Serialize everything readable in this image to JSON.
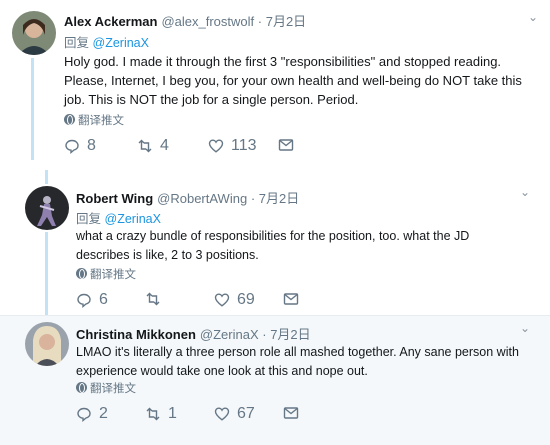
{
  "reply_label": "回复",
  "translate_label": "翻译推文",
  "colors": {
    "link": "#1b95e0",
    "muted": "#657786",
    "thread": "#c4e2f5"
  },
  "tweets": [
    {
      "name": "Alex Ackerman",
      "handle": "@alex_frostwolf",
      "date": "· 7月2日",
      "reply_to": "@ZerinaX",
      "text": "Holy god. I made it through the first 3 \"responsibilities\" and stopped reading. Please, Internet, I beg you, for your own health and well-being do NOT take this job. This is NOT the job for a single person. Period.",
      "replies": "8",
      "retweets": "4",
      "likes": "113"
    },
    {
      "name": "Robert Wing",
      "handle": "@RobertAWing",
      "date": "· 7月2日",
      "reply_to": "@ZerinaX",
      "text": "what a crazy bundle of responsibilities for the position, too. what the JD describes is like, 2 to 3 positions.",
      "replies": "6",
      "retweets": "",
      "likes": "69"
    },
    {
      "name": "Christina Mikkonen",
      "handle": "@ZerinaX",
      "date": "· 7月2日",
      "text": "LMAO it's literally a three person role all mashed together. Any sane person with experience would take one look at this and nope out.",
      "replies": "2",
      "retweets": "1",
      "likes": "67"
    }
  ]
}
